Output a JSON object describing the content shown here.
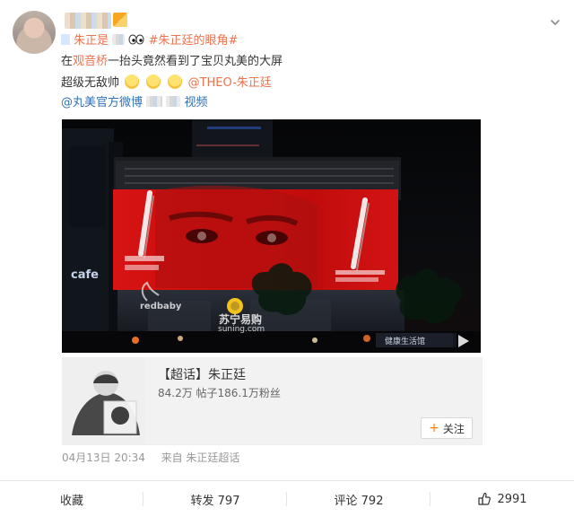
{
  "post": {
    "line1": {
      "topic_text": "朱正是",
      "topic2": "#朱正廷的眼角#"
    },
    "line2": {
      "text": "在观音桥一抬头竟然看到了宝贝丸美的大屏",
      "link": "观音桥"
    },
    "line3": {
      "text": "超级无敌帅",
      "mention": "@THEO-朱正廷"
    },
    "line4": {
      "mention": "@丸美官方微博",
      "video_label": "视频"
    }
  },
  "image": {
    "signs": {
      "cafe": "cafe",
      "redbaby": "redbaby",
      "suning_cn": "苏宁易购",
      "suning_en": "suning.com",
      "right_shop": "健康生活馆"
    }
  },
  "topic_card": {
    "title": "【超话】朱正廷",
    "stats": "84.2万 帖子186.1万粉丝",
    "follow_label": "关注"
  },
  "meta": {
    "time": "04月13日 20:34",
    "source": "来自 朱正廷超话"
  },
  "actions": [
    {
      "label": "收藏"
    },
    {
      "label": "转发 797"
    },
    {
      "label": "评论 792"
    },
    {
      "label": "2991"
    }
  ]
}
